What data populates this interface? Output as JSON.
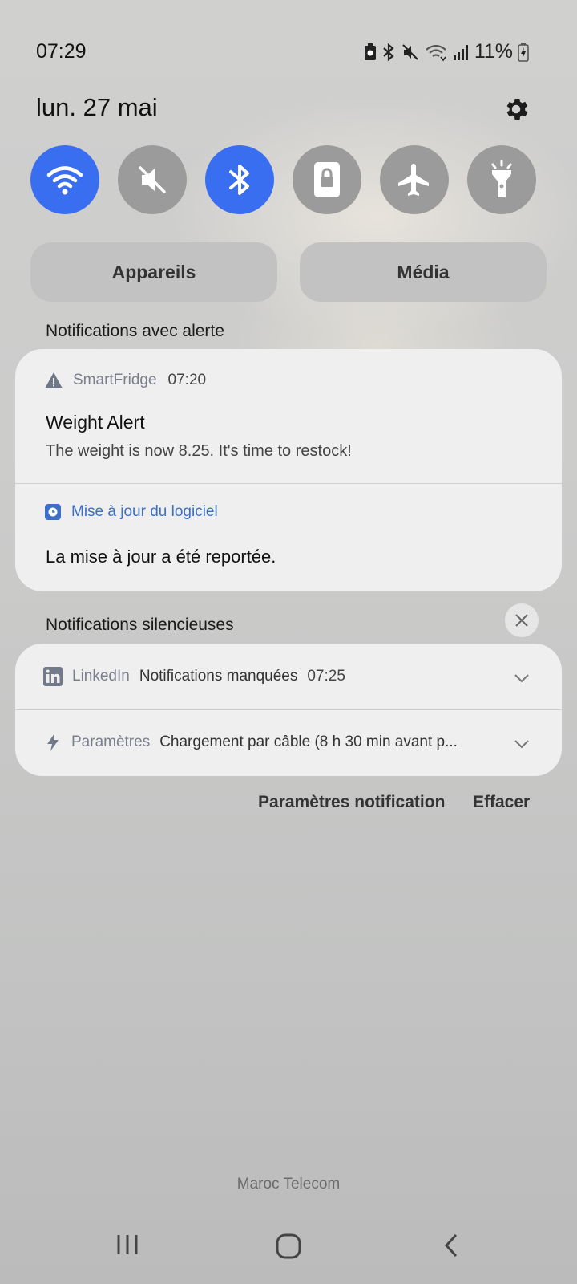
{
  "status_bar": {
    "time": "07:29",
    "battery": "11%",
    "icons": [
      "battery-saver-icon",
      "bluetooth-icon",
      "mute-icon",
      "wifi-data-icon",
      "signal-icon",
      "battery-charging-icon"
    ]
  },
  "header": {
    "date": "lun. 27 mai",
    "settings_icon": "gear-icon"
  },
  "quick_settings": [
    {
      "name": "wifi",
      "icon": "wifi-icon",
      "state": "on"
    },
    {
      "name": "sound",
      "icon": "mute-icon",
      "state": "off"
    },
    {
      "name": "bluetooth",
      "icon": "bluetooth-icon",
      "state": "on"
    },
    {
      "name": "orientation-lock",
      "icon": "lock-icon",
      "state": "off"
    },
    {
      "name": "airplane",
      "icon": "airplane-icon",
      "state": "off"
    },
    {
      "name": "flashlight",
      "icon": "flashlight-icon",
      "state": "off"
    }
  ],
  "pills": {
    "devices": "Appareils",
    "media": "Média"
  },
  "alert_section": {
    "label": "Notifications avec alerte",
    "smartfridge": {
      "app": "SmartFridge",
      "time": "07:20",
      "title": "Weight Alert",
      "body": "The weight is now 8.25. It's time to restock!"
    },
    "software_update": {
      "app": "Mise à jour du logiciel",
      "body": "La mise à jour a été reportée."
    }
  },
  "silent_section": {
    "label": "Notifications silencieuses",
    "linkedin": {
      "app": "LinkedIn",
      "text": "Notifications manquées",
      "time": "07:25"
    },
    "settings": {
      "app": "Paramètres",
      "text": "Chargement par câble (8 h 30 min avant p..."
    }
  },
  "actions": {
    "notification_settings": "Paramètres notification",
    "clear": "Effacer"
  },
  "carrier": "Maroc Telecom",
  "colors": {
    "toggle_on": "#3a6ef0",
    "toggle_off": "#9b9b9b",
    "link_blue": "#3b6fc9"
  }
}
